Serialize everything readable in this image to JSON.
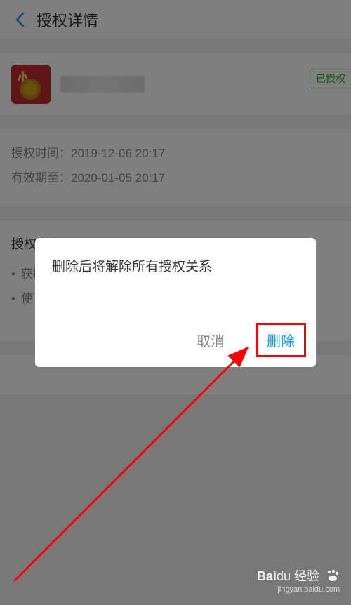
{
  "header": {
    "title": "授权详情"
  },
  "app": {
    "status_badge": "已授权"
  },
  "details": {
    "auth_time_label": "授权时间：",
    "auth_time_value": "2019-12-06 20:17",
    "valid_until_label": "有效期至：",
    "valid_until_value": "2020-01-05 20:17"
  },
  "content": {
    "title": "授权内容：",
    "items": [
      "获取你的公开信息(昵称、头像、性别等)",
      "使"
    ]
  },
  "dialog": {
    "message": "删除后将解除所有授权关系",
    "cancel_label": "取消",
    "confirm_label": "删除"
  },
  "watermark": {
    "brand_prefix": "Bai",
    "brand_suffix": "du",
    "brand_cn": "经验",
    "url": "jingyan.baidu.com"
  }
}
